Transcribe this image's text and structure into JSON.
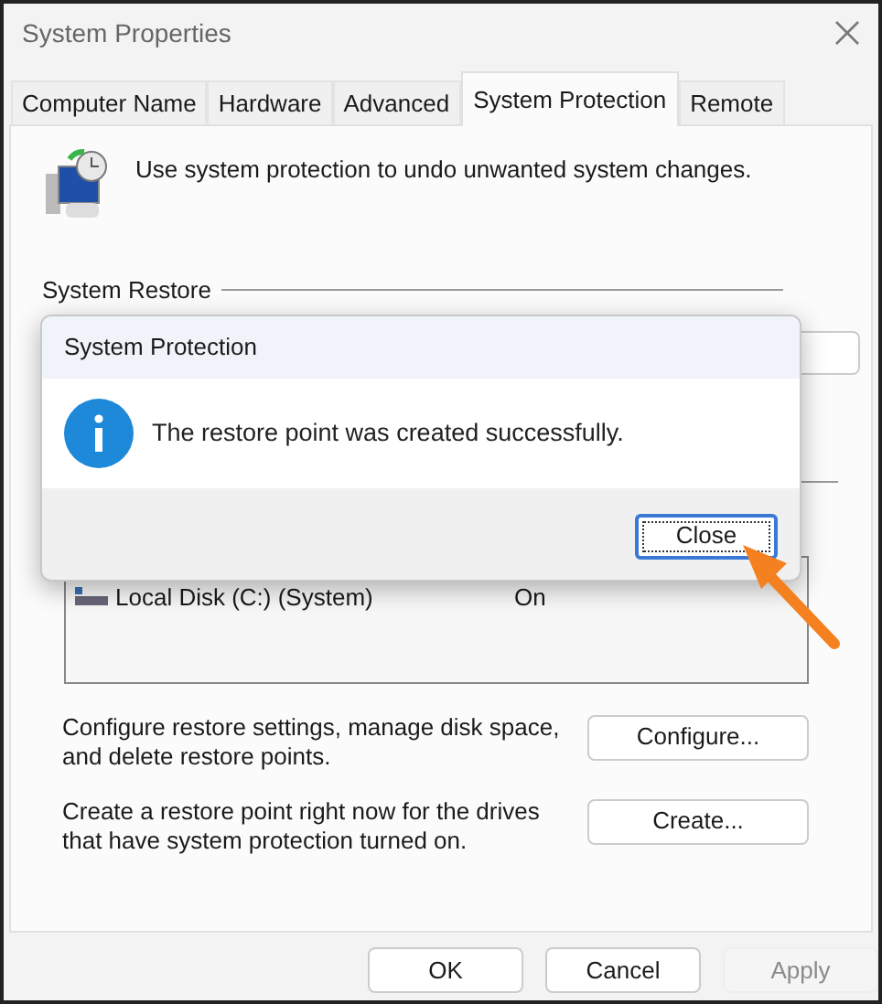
{
  "window": {
    "title": "System Properties"
  },
  "tabs": [
    {
      "label": "Computer Name",
      "selected": false
    },
    {
      "label": "Hardware",
      "selected": false
    },
    {
      "label": "Advanced",
      "selected": false
    },
    {
      "label": "System Protection",
      "selected": true
    },
    {
      "label": "Remote",
      "selected": false
    }
  ],
  "intro": "Use system protection to undo unwanted system changes.",
  "group_label": "System Restore",
  "drives": [
    {
      "name": "Local Disk (C:) (System)",
      "status": "On"
    }
  ],
  "actions": [
    {
      "text": "Configure restore settings, manage disk space, and delete restore points.",
      "button": "Configure..."
    },
    {
      "text": "Create a restore point right now for the drives that have system protection turned on.",
      "button": "Create..."
    }
  ],
  "buttons": [
    {
      "label": "OK",
      "disabled": false
    },
    {
      "label": "Cancel",
      "disabled": false
    },
    {
      "label": "Apply",
      "disabled": true
    }
  ],
  "dialog": {
    "title": "System Protection",
    "message": "The restore point was created successfully.",
    "button": "Close"
  }
}
